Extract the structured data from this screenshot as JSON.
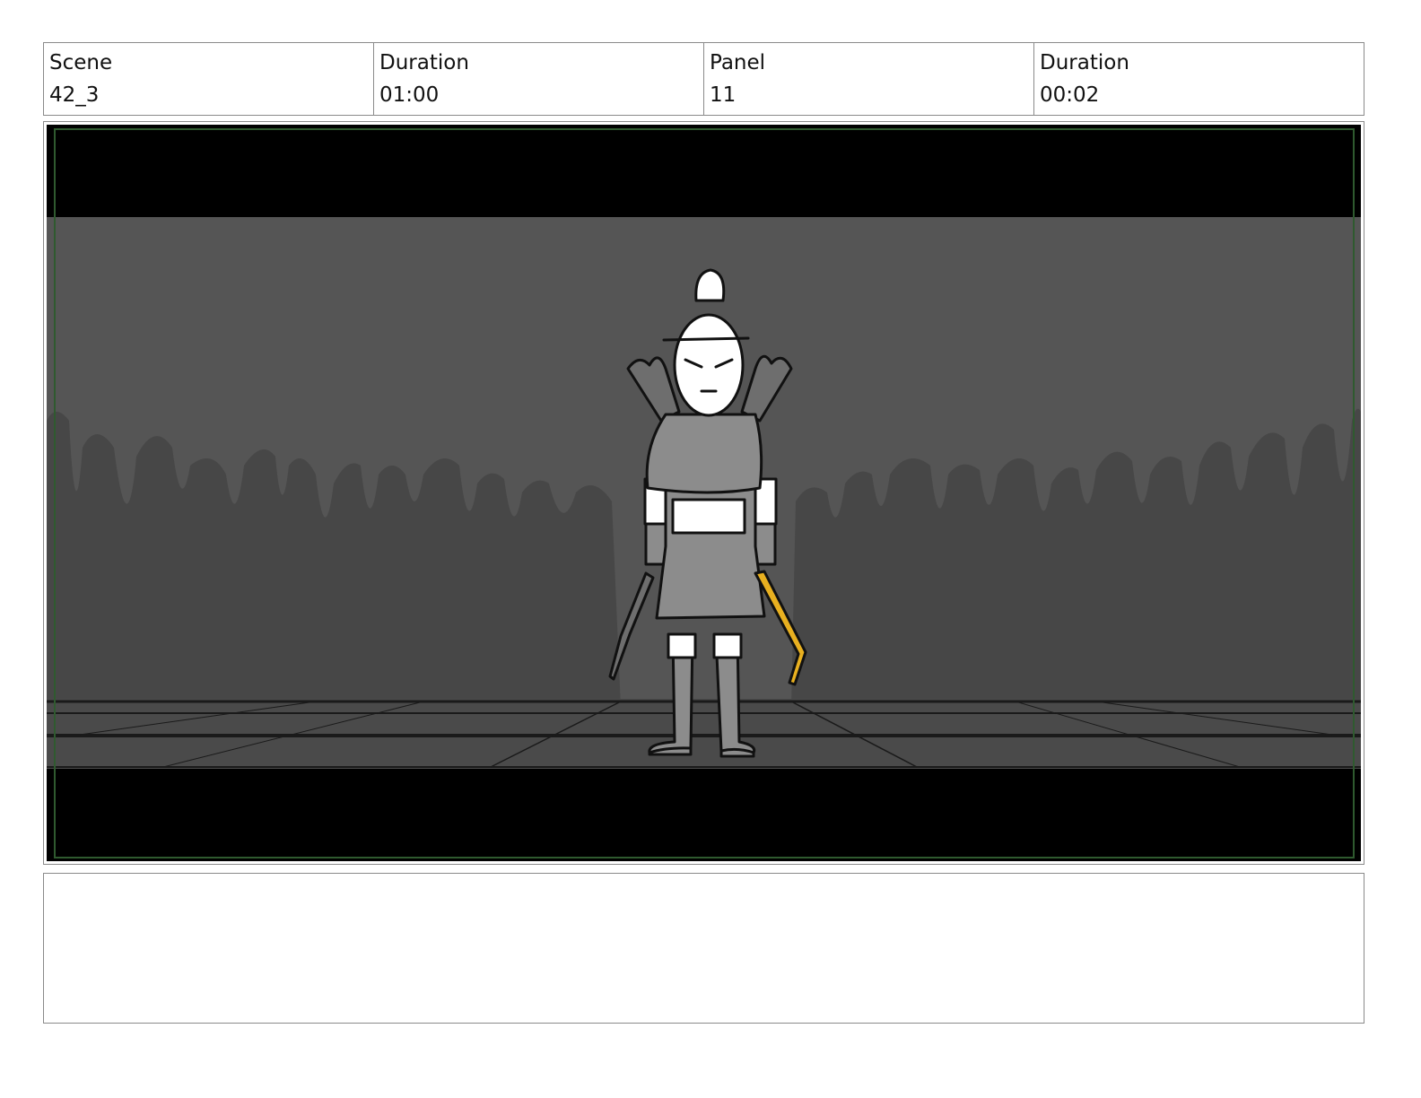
{
  "header": {
    "scene_label": "Scene",
    "scene_value": "42_3",
    "duration_label": "Duration",
    "duration_value": "01:00",
    "panel_label": "Panel",
    "panel_value": "11",
    "panel_duration_label": "Duration",
    "panel_duration_value": "00:02"
  },
  "notes": {
    "text": ""
  },
  "colors": {
    "letterbox": "#000000",
    "safe_frame": "#2f5a2f",
    "background_wall": "#555555",
    "crowd_silhouette": "#474747",
    "floor": "#4a4a4a",
    "armor": "#8c8c8c",
    "skin": "#ffffff",
    "weapon_accent": "#e8b020"
  }
}
